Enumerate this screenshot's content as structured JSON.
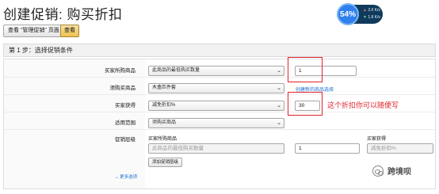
{
  "header": {
    "title": "创建促销: 购买折扣",
    "view_promotions_button": "查看 \"管理促销\" 页面",
    "view_button": "查看"
  },
  "speed_widget": {
    "percent": "54%",
    "upload": "2.0 K/s",
    "download": "1.8 K/s"
  },
  "step": {
    "title": "第 1 步：选择促销条件"
  },
  "form": {
    "buyer_purchases": {
      "label": "买家所购商品",
      "select_value": "此商品的最低购买数量",
      "input_value": "1"
    },
    "purchased_items": {
      "label": "须购买商品",
      "select_value": "木盒匹件套",
      "link": "创建新的商品选择"
    },
    "buyer_gets": {
      "label": "买家获得",
      "select_value": "减免折扣%",
      "input_value": "30"
    },
    "applies_to": {
      "label": "适用范围",
      "select_value": "须购买商品"
    },
    "tiers": {
      "label": "促销层级",
      "col_buyer_purchases": "买家所购商品",
      "col_buyer_gets": "买家获得",
      "tier_select_value": "此商品的最低购买数量",
      "tier_input_value": "1",
      "tier_gets_value": "减免折扣%",
      "add_tier_button": "添加促销层级"
    },
    "more_options": "更多选项"
  },
  "annotation": {
    "text": "这个折扣你可以随便写",
    "color": "#e0242d"
  },
  "watermark": {
    "text": "跨境呗"
  }
}
